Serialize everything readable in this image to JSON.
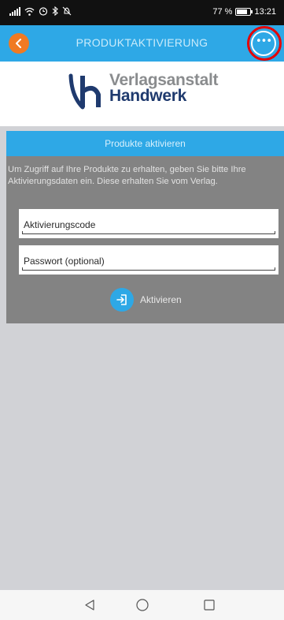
{
  "status_bar": {
    "left_icons": [
      "signal-icon",
      "wifi-icon",
      "alarm-icon",
      "bluetooth-icon",
      "mute-icon"
    ],
    "battery_text": "77 %",
    "battery_level_percent": 77,
    "time": "13:21"
  },
  "header": {
    "title": "PRODUKTAKTIVIERUNG",
    "back_icon": "chevron-left-icon",
    "more_icon": "more-options-icon",
    "colors": {
      "bar": "#2ea8e6",
      "back": "#f07a22",
      "highlight": "#e60000"
    }
  },
  "logo": {
    "line1": "Verlagsanstalt",
    "line2": "Handwerk",
    "colors": {
      "mark": "#1f3a6e",
      "text_gray": "#8a8c8e"
    }
  },
  "section": {
    "title": "Produkte aktivieren"
  },
  "form": {
    "info": "Um Zugriff auf Ihre Produkte zu erhalten, geben Sie bitte Ihre Aktivierungsdaten ein. Diese erhalten Sie vom Verlag.",
    "activation_code_placeholder": "Aktivierungscode",
    "password_placeholder": "Passwort (optional)",
    "activate_label": "Aktivieren",
    "activate_icon": "sign-in-icon"
  },
  "nav": {
    "back_icon": "triangle-back-icon",
    "home_icon": "circle-home-icon",
    "recents_icon": "square-recents-icon"
  }
}
